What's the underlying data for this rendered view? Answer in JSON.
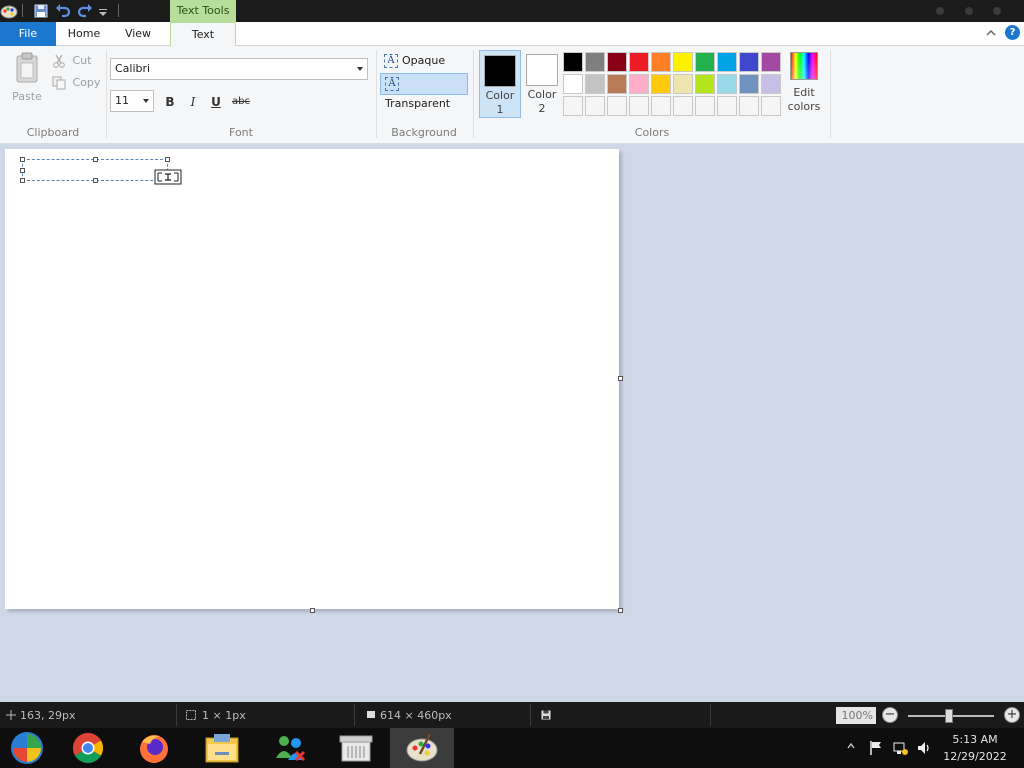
{
  "window": {
    "context_tab_label": "Text Tools"
  },
  "tabs": {
    "file": "File",
    "home": "Home",
    "view": "View",
    "text": "Text"
  },
  "help_icon_label": "?",
  "ribbon": {
    "clipboard": {
      "paste": "Paste",
      "cut": "Cut",
      "copy": "Copy",
      "group_label": "Clipboard"
    },
    "font": {
      "family": "Calibri",
      "size": "11",
      "bold": "B",
      "italic": "I",
      "underline": "U",
      "strikethrough": "abc",
      "group_label": "Font"
    },
    "background": {
      "opaque": "Opaque",
      "transparent": "Transparent",
      "selected": "transparent",
      "glyph": "A",
      "group_label": "Background"
    },
    "colors": {
      "color1_label": "Color",
      "color1_num": "1",
      "color2_label": "Color",
      "color2_num": "2",
      "color1_value": "#000000",
      "color2_value": "#ffffff",
      "edit_label_1": "Edit",
      "edit_label_2": "colors",
      "group_label": "Colors",
      "palette_row1": [
        "#000000",
        "#7f7f7f",
        "#880015",
        "#ed1c24",
        "#ff7f27",
        "#fff200",
        "#22b14c",
        "#00a2e8",
        "#3f48cc",
        "#a349a4"
      ],
      "palette_row2": [
        "#ffffff",
        "#c3c3c3",
        "#b97a57",
        "#ffaec9",
        "#ffc90e",
        "#efe4b0",
        "#b5e61d",
        "#99d9ea",
        "#7092be",
        "#c8bfe7"
      ],
      "palette_row3": [
        "#f5f5f5",
        "#f5f5f5",
        "#f5f5f5",
        "#f5f5f5",
        "#f5f5f5",
        "#f5f5f5",
        "#f5f5f5",
        "#f5f5f5",
        "#f5f5f5",
        "#f5f5f5"
      ]
    }
  },
  "status": {
    "cursor_pos": "163, 29px",
    "selection_size": "1 × 1px",
    "image_size": "614 × 460px",
    "zoom": "100%",
    "zoom_out": "−",
    "zoom_in": "+"
  },
  "taskbar": {
    "time": "5:13 AM",
    "date": "12/29/2022",
    "apps": [
      "start-orb",
      "chrome",
      "firefox",
      "file-explorer",
      "messenger",
      "archive",
      "paint"
    ]
  }
}
